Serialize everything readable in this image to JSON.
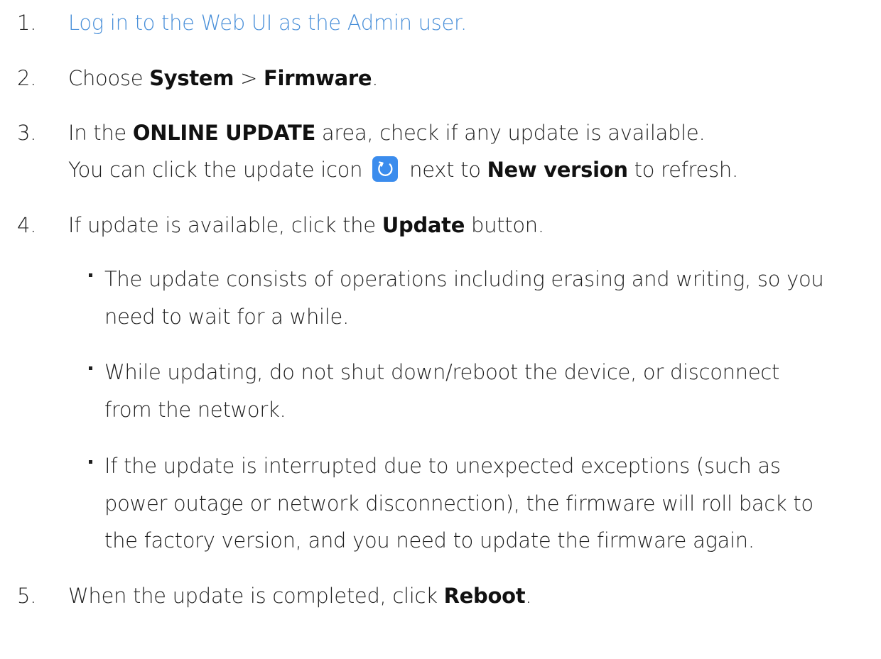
{
  "steps": [
    {
      "number": "1.",
      "link_text": "Log in to the Web UI as the Admin user."
    },
    {
      "number": "2.",
      "t1": "Choose ",
      "b1": "System",
      "t2": " > ",
      "b2": "Firmware",
      "t3": "."
    },
    {
      "number": "3.",
      "t1": "In the ",
      "b1": "ONLINE UPDATE",
      "t2": " area, check if any update is available.",
      "line2_t1": "You can click the update icon",
      "icon": "refresh-icon",
      "line2_t2": "next to ",
      "line2_b1": "New version",
      "line2_t3": " to refresh."
    },
    {
      "number": "4.",
      "t1": "If update is available, click the ",
      "b1": "Update",
      "t2": " button.",
      "bullets": [
        {
          "lines": [
            "The update consists of operations including erasing and writing, so you",
            "need to wait for a while."
          ]
        },
        {
          "lines": [
            "While updating, do not shut down/reboot the device, or disconnect",
            "from the network."
          ]
        },
        {
          "lines": [
            "If the update is interrupted due to unexpected exceptions (such as",
            "power outage or network disconnection), the firmware will roll back to",
            "the factory version, and you need to update the firmware again."
          ]
        }
      ]
    },
    {
      "number": "5.",
      "t1": "When the update is completed, click ",
      "b1": "Reboot",
      "t2": "."
    }
  ],
  "colors": {
    "link": "#4a90d9",
    "icon_bg": "#3b8ced",
    "text": "#1f1f1f"
  }
}
